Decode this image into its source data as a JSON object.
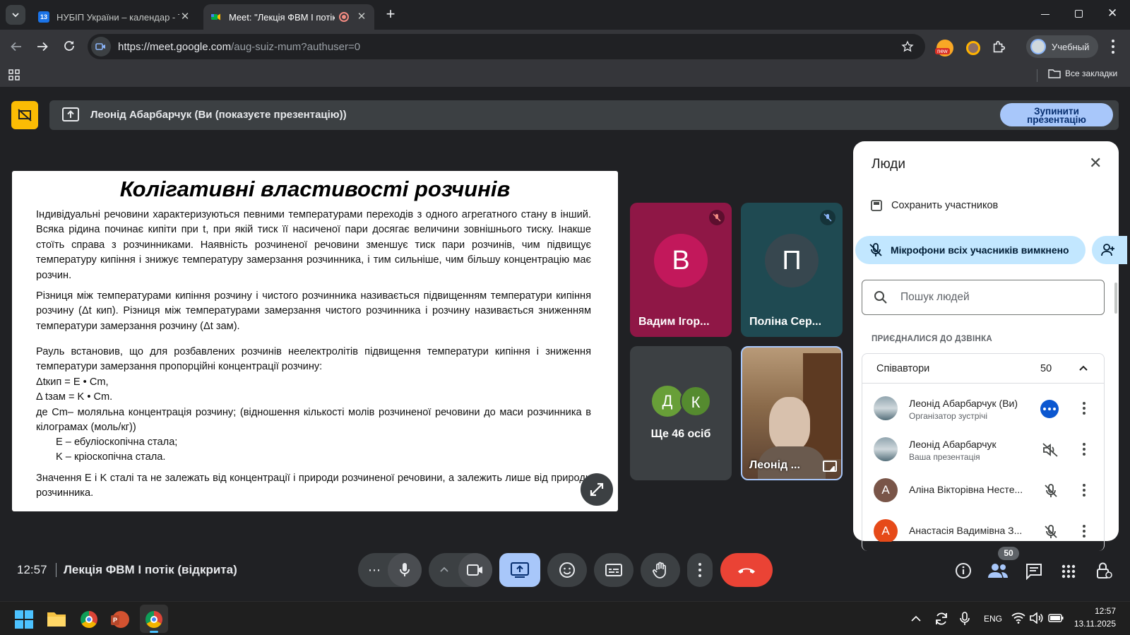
{
  "browser": {
    "tabs": [
      {
        "title": "НУБІП України – календар - Ти",
        "favicon_color": "#1a73e8",
        "favicon_text": "13"
      },
      {
        "title": "Meet: \"Лекція ФВМ І потік",
        "favicon_color": "#00832d"
      }
    ],
    "new_tab_icon": "plus-icon",
    "url_domain": "https://meet.google.com",
    "url_path": "/aug-suiz-mum?authuser=0",
    "profile_name": "Учебный",
    "bookmarks_label": "Все закладки",
    "new_badge": "new"
  },
  "meet": {
    "presenting_banner": "Леонід Абарбарчук (Ви (показуєте презентацію))",
    "stop_presenting_label": "Зупинити презентацію",
    "slide": {
      "title": "Колігативні властивості розчинів",
      "p1": "Індивідуальні речовини характеризуються певними температурами переходів з одного агрегатного стану в інший. Всяка рідина починає кипіти при t, при якій тиск її насиченої пари досягає величини зовнішнього тиску. Інакше стоїть справа з розчинниками. Наявність розчиненої речовини зменшує тиск пари розчинів, чим підвищує температуру кипіння і знижує температуру замерзання розчинника, і тим сильніше, чим більшу концентрацію має розчин.",
      "p2": "Різниця між температурами кипіння розчину і чистого розчинника називається  підвищенням температури кипіння розчину (Δt кип). Різниця між температурами замерзання чистого розчинника і розчину називається зниженням температури замерзання розчину (Δt зам).",
      "p3": "Рауль встановив, що для розбавлених розчинів неелектролітів підвищення температури кипіння і зниження температури замерзання пропорційні концентрації розчину:",
      "f1": "Δtкип = E • Cm,",
      "f2": "Δ tзам = K • Cm.",
      "p4": "де Cm– моляльна концентрація розчину; (відношення кількості молів розчиненої речовини до маси розчинника в кілограмах (моль/кг))",
      "e1": "E – ебуліоскопічна стала;",
      "e2": "K – кріоскопічна стала.",
      "p5": "Значення E і K сталі та не залежать від концентрації і природи розчиненої речовини, а залежить лише від природи розчинника."
    },
    "tiles": [
      {
        "initial": "В",
        "name": "Вадим Ігор...",
        "bg": "#8f1746",
        "avatar": "#c2185b"
      },
      {
        "initial": "П",
        "name": "Поліна Сер...",
        "bg": "#1f4a52",
        "avatar": "#37474f"
      }
    ],
    "more_tile": {
      "initials": [
        "Д",
        "К"
      ],
      "label": "Ще 46 осіб"
    },
    "self_tile_name": "Леонід ...",
    "time": "12:57",
    "meeting_title": "Лекція ФВМ І потік (відкрита)",
    "people_count_badge": "50"
  },
  "people_panel": {
    "title": "Люди",
    "save_label": "Сохранить участников",
    "mute_all_label": "Мікрофони всіх учасників вимкнено",
    "search_placeholder": "Пошук людей",
    "section_label": "ПРИЄДНАЛИСЯ ДО ДЗВІНКА",
    "group_label": "Співавтори",
    "group_count": "50",
    "participants": [
      {
        "name": "Леонід Абарбарчук (Ви)",
        "sub": "Організатор зустрічі",
        "avatar": "photo",
        "status": "more-icon"
      },
      {
        "name": "Леонід Абарбарчук",
        "sub": "Ваша презентація",
        "avatar": "photo",
        "status": "volume-off-icon"
      },
      {
        "name": "Аліна Вікторівна Несте...",
        "sub": "",
        "avatar": "А",
        "avatar_color": "#795548",
        "status": "mic-off-icon"
      },
      {
        "name": "Анастасія Вадимівна З...",
        "sub": "",
        "avatar": "А",
        "avatar_color": "#e64a19",
        "status": "mic-off-icon"
      }
    ]
  },
  "taskbar": {
    "lang": "ENG",
    "time": "12:57",
    "date": "13.11.2025"
  },
  "colors": {
    "accent": "#a8c7fa",
    "end_call": "#ea4335",
    "banner_yellow": "#fbbc04"
  }
}
